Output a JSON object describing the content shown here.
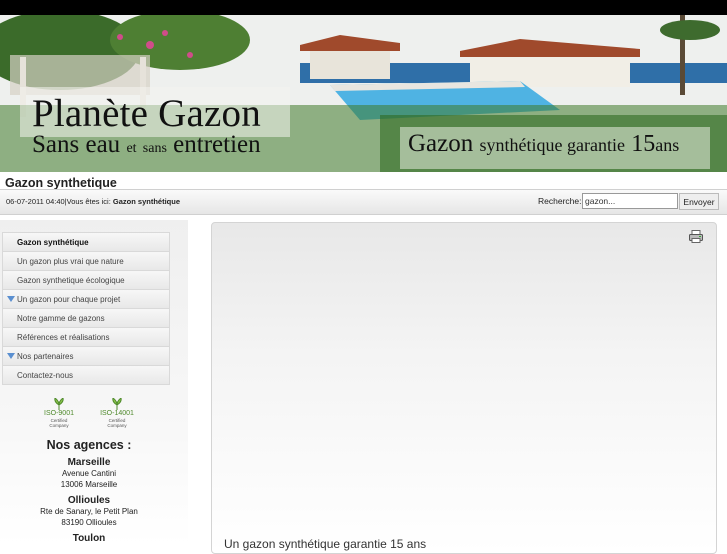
{
  "banner": {
    "title": "Planète Gazon",
    "tagline_left_1": "Sans",
    "tagline_left_2": "eau",
    "tagline_left_3": "et",
    "tagline_left_4": "sans",
    "tagline_left_5": "entretien",
    "tagline_right_1": "Gazon",
    "tagline_right_2": "synthétique garantie",
    "tagline_right_3": "15",
    "tagline_right_4": "ans"
  },
  "page": {
    "title": "Gazon synthetique",
    "datetime": "06-07-2011 04:40",
    "crumb_prefix": "|Vous êtes ici:",
    "crumb_current": "Gazon synthétique"
  },
  "search": {
    "label": "Recherche:",
    "value": "gazon...",
    "button": "Envoyer"
  },
  "menu": {
    "items": [
      {
        "label": "Gazon synthétique",
        "active": true,
        "arrow": false
      },
      {
        "label": "Un gazon plus vrai que nature",
        "active": false,
        "arrow": false
      },
      {
        "label": "Gazon synthetique écologique",
        "active": false,
        "arrow": false
      },
      {
        "label": "Un gazon pour chaque projet",
        "active": false,
        "arrow": true
      },
      {
        "label": "Notre gamme de gazons",
        "active": false,
        "arrow": false
      },
      {
        "label": "Références et réalisations",
        "active": false,
        "arrow": false
      },
      {
        "label": "Nos partenaires",
        "active": false,
        "arrow": true
      },
      {
        "label": "Contactez-nous",
        "active": false,
        "arrow": false
      }
    ]
  },
  "certifications": [
    {
      "name": "ISO-9001",
      "sub1": "Certified",
      "sub2": "Company"
    },
    {
      "name": "ISO-14001",
      "sub1": "Certified",
      "sub2": "Company"
    }
  ],
  "agencies": {
    "title": "Nos agences :",
    "list": [
      {
        "city": "Marseille",
        "line1": "Avenue Cantini",
        "line2": "13006 Marseille"
      },
      {
        "city": "Ollioules",
        "line1": "Rte de Sanary, le Petit Plan",
        "line2": "83190 Ollioules"
      },
      {
        "city": "Toulon",
        "line1": "",
        "line2": ""
      }
    ]
  },
  "content": {
    "partial_text": "Un gazon synthétique garantie 15 ans"
  }
}
